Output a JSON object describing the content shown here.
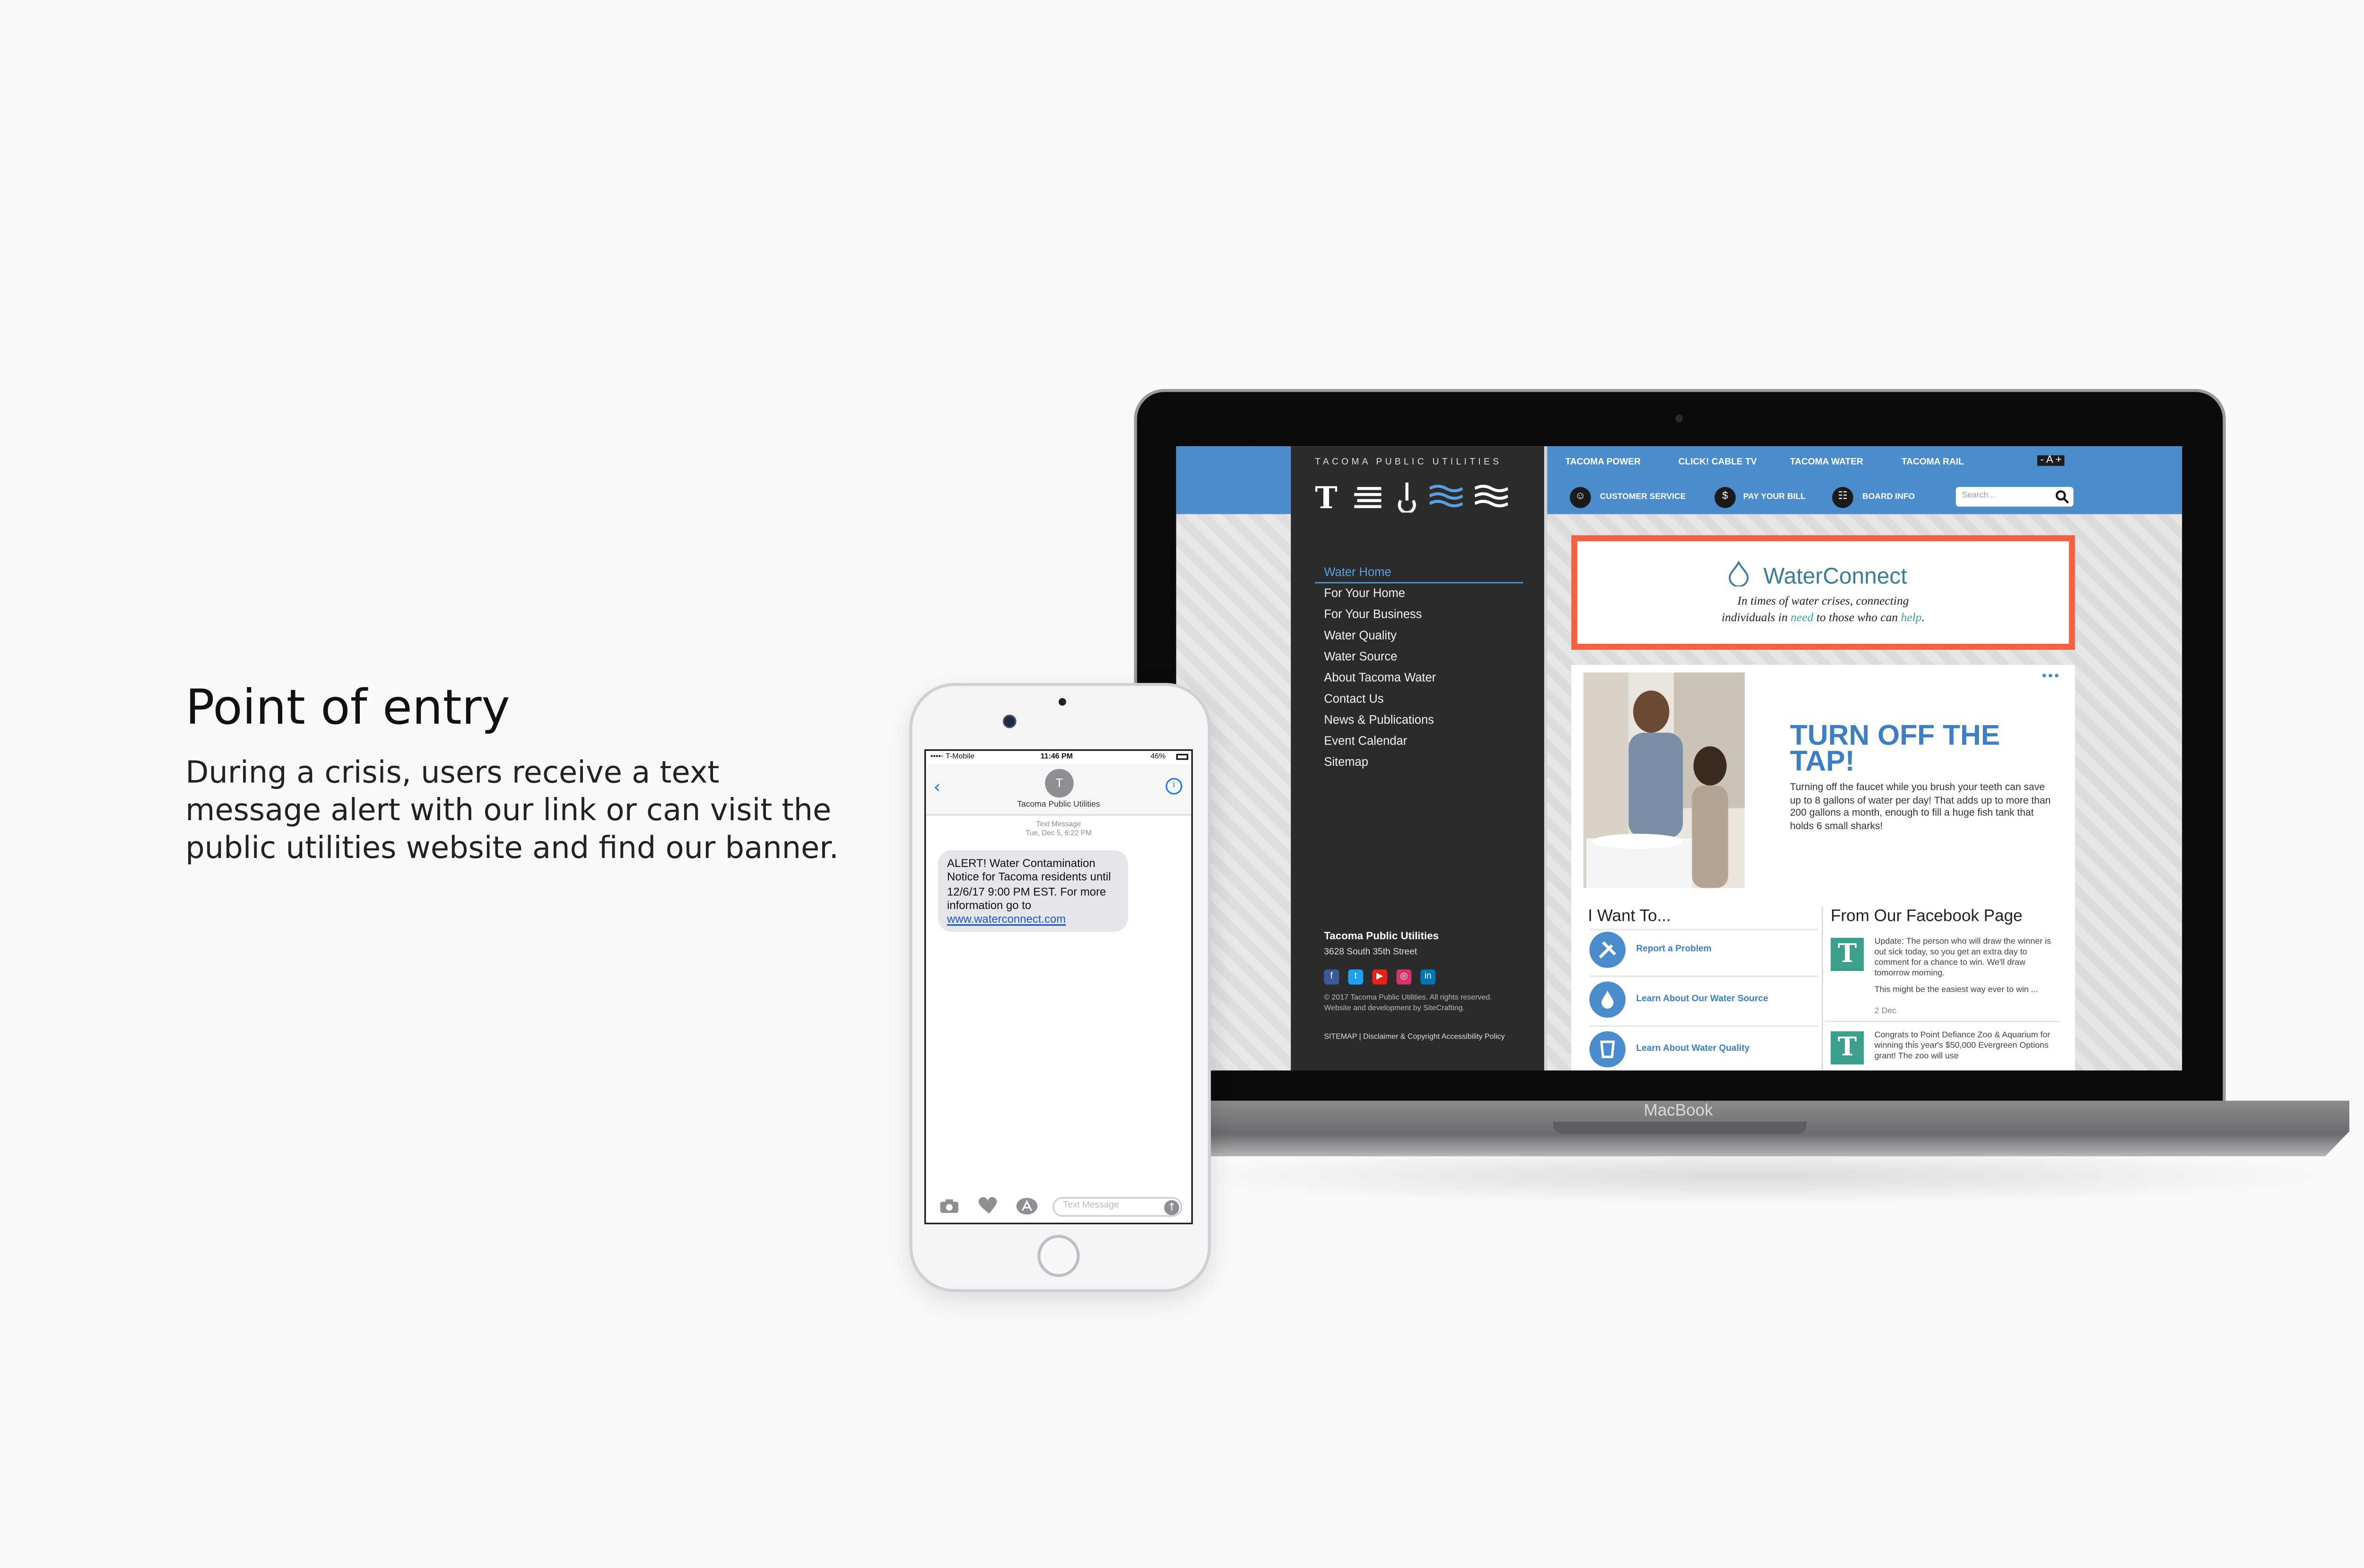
{
  "intro": {
    "headline": "Point of entry",
    "description": "During a crisis, users receive a text message alert with our link or can visit the public utilities website and find our banner."
  },
  "laptop": {
    "brand": "MacBook",
    "site": {
      "brand_name": "TACOMA PUBLIC UTILITIES",
      "top_nav": [
        "TACOMA POWER",
        "CLICK! CABLE TV",
        "TACOMA WATER",
        "TACOMA RAIL"
      ],
      "font_size_control": "- A +",
      "utility_links": [
        {
          "icon": "people-icon",
          "glyph": "☺",
          "label": "CUSTOMER SERVICE"
        },
        {
          "icon": "dollar-icon",
          "glyph": "$",
          "label": "PAY YOUR BILL"
        },
        {
          "icon": "clipboard-icon",
          "glyph": "☷",
          "label": "BOARD INFO"
        }
      ],
      "search_placeholder": "Search...",
      "sidebar_nav": [
        "Water Home",
        "For Your Home",
        "For Your Business",
        "Water Quality",
        "Water Source",
        "About Tacoma Water",
        "Contact Us",
        "News & Publications",
        "Event Calendar",
        "Sitemap"
      ],
      "sidebar_active": "Water Home",
      "footer": {
        "title": "Tacoma Public Utilities",
        "address": "3628 South 35th Street",
        "social": [
          "f",
          "t",
          "▶",
          "◎",
          "in"
        ],
        "copyright": "© 2017 Tacoma Public Utilities. All rights reserved. Website and development by SiteCrafting.",
        "links": "SITEMAP | Disclaimer & Copyright Accessibility Policy"
      },
      "banner": {
        "title": "WaterConnect",
        "tagline_1": "In times of water crises, connecting",
        "tagline_2_pre": "individuals in ",
        "tagline_2_need": "need",
        "tagline_2_mid": " to those who can ",
        "tagline_2_help": "help",
        "tagline_2_post": "."
      },
      "hero": {
        "title": "TURN OFF THE TAP!",
        "body": "Turning off the faucet while you brush your teeth can save up to 8 gallons of water per day! That adds up to more than 200 gallons a month, enough to fill a huge fish tank that holds 6 small sharks!",
        "more": "•••"
      },
      "i_want_to": {
        "title": "I Want To...",
        "items": [
          {
            "icon": "wrench-icon",
            "label": "Report a Problem"
          },
          {
            "icon": "water-drop-icon",
            "label": "Learn About Our Water Source"
          },
          {
            "icon": "glass-icon",
            "label": "Learn About Water Quality"
          }
        ]
      },
      "facebook": {
        "title": "From Our Facebook Page",
        "posts": [
          {
            "text": "Update: The person who will draw the winner is out sick today, so you get an extra day to comment for a chance to win. We'll draw tomorrow morning.",
            "text2": "This might be the easiest way ever to win ...",
            "date": "2 Dec"
          },
          {
            "text": "Congrats to Point Defiance Zoo & Aquarium for winning this year's $50,000 Evergreen Options grant! The zoo will use",
            "text2": "",
            "date": ""
          }
        ]
      }
    }
  },
  "phone": {
    "status": {
      "carrier": "••••◦ T-Mobile",
      "time": "11:46 PM",
      "battery": "46%"
    },
    "contact_initial": "T",
    "contact_name": "Tacoma Public Utilities",
    "meta_line_1": "Text Message",
    "meta_line_2": "Tue, Dec 5, 6:22 PM",
    "message": "ALERT! Water Contamination Notice for Tacoma residents until 12/6/17 9:00 PM EST. For more information go to",
    "message_link": "www.waterconnect.com",
    "composer_placeholder": "Text Message"
  },
  "colors": {
    "site_blue": "#4b8ccd",
    "banner_border": "#f0613f",
    "ios_blue": "#1a7cf6",
    "teal": "#3c9f8c"
  }
}
